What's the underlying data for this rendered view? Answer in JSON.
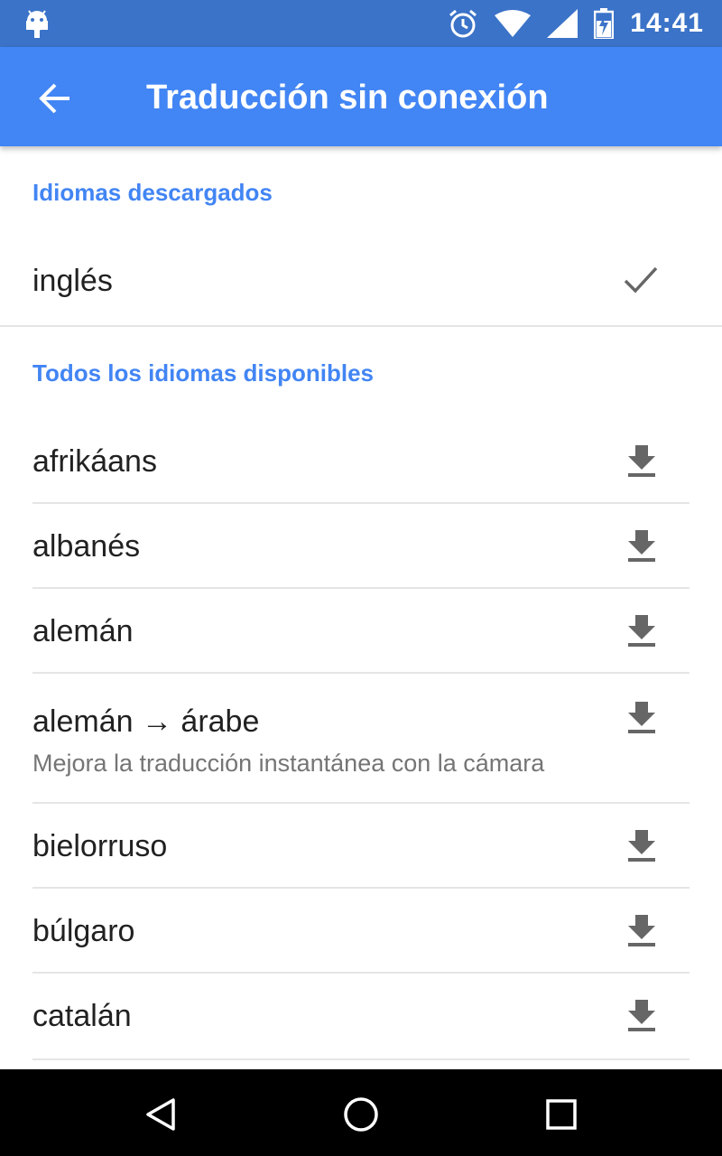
{
  "status_bar": {
    "time": "14:41",
    "icons": [
      "android-debug-icon",
      "alarm-icon",
      "wifi-icon",
      "cell-signal-icon",
      "battery-charging-icon"
    ]
  },
  "app_bar": {
    "title": "Traducción sin conexión",
    "back_icon": "arrow-back-icon",
    "color": "#4285f4"
  },
  "downloaded_section": {
    "header": "Idiomas descargados",
    "items": [
      {
        "label": "inglés",
        "icon": "check-icon"
      }
    ]
  },
  "available_section": {
    "header": "Todos los idiomas disponibles",
    "items": [
      {
        "label": "afrikáans",
        "icon": "download-icon"
      },
      {
        "label": "albanés",
        "icon": "download-icon"
      },
      {
        "label": "alemán",
        "icon": "download-icon"
      },
      {
        "label": "alemán → árabe",
        "sublabel": "Mejora la traducción instantánea con la cámara",
        "icon": "download-icon"
      },
      {
        "label": "bielorruso",
        "icon": "download-icon"
      },
      {
        "label": "búlgaro",
        "icon": "download-icon"
      },
      {
        "label": "catalán",
        "icon": "download-icon"
      }
    ]
  },
  "nav_bar": {
    "buttons": [
      "back-triangle-icon",
      "home-circle-icon",
      "recents-square-icon"
    ]
  },
  "colors": {
    "status_bar": "#3b73c8",
    "accent": "#4285f4",
    "text_primary": "#212121",
    "text_secondary": "#757575",
    "icon_gray": "#666666"
  }
}
